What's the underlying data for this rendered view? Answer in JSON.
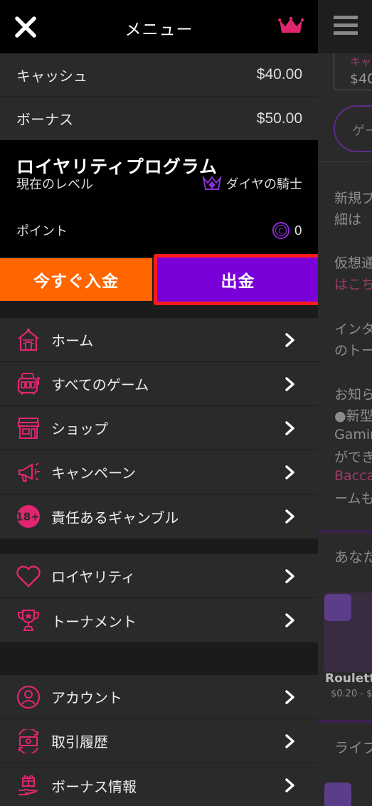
{
  "header": {
    "title": "メニュー"
  },
  "balances": [
    {
      "label": "キャッシュ",
      "value": "$40.00"
    },
    {
      "label": "ボーナス",
      "value": "$50.00"
    }
  ],
  "loyalty": {
    "title": "ロイヤリティプログラム",
    "level_label": "現在のレベル",
    "level_value": "ダイヤの騎士",
    "points_label": "ポイント",
    "points_value": "0"
  },
  "actions": {
    "deposit_label": "今すぐ入金",
    "withdraw_label": "出金"
  },
  "menu_groups": [
    [
      {
        "label": "ホーム",
        "icon": "house-icon"
      },
      {
        "label": "すべてのゲーム",
        "icon": "slot-machine-icon"
      },
      {
        "label": "ショップ",
        "icon": "shop-icon"
      },
      {
        "label": "キャンペーン",
        "icon": "megaphone-icon"
      },
      {
        "label": "責任あるギャンブル",
        "icon": "age-18-icon"
      }
    ],
    [
      {
        "label": "ロイヤリティ",
        "icon": "heart-icon"
      },
      {
        "label": "トーナメント",
        "icon": "trophy-icon"
      }
    ],
    [
      {
        "label": "アカウント",
        "icon": "user-icon"
      },
      {
        "label": "取引履歴",
        "icon": "money-exchange-icon"
      },
      {
        "label": "ボーナス情報",
        "icon": "gift-hand-icon"
      }
    ]
  ],
  "background_page": {
    "balance_label_fragment": "キャ",
    "balance_value_fragment": "$40",
    "pill_fragment": "ゲー",
    "text_fragments": [
      "新規プ",
      "細は",
      "仮想通",
      "はこち",
      "インタ",
      "のトー",
      "お知ら",
      "●新型",
      "Gamin",
      "ができ",
      "Bacca",
      "ームも",
      "あなた",
      "Roulett",
      "$0.20 - $",
      "ライブ"
    ]
  },
  "colors": {
    "accent_pink": "#e0266f",
    "deposit_orange": "#ff6600",
    "withdraw_purple": "#7a00d9",
    "highlight_red": "#ff1a1a",
    "diamond_purple": "#8b2fd6"
  }
}
